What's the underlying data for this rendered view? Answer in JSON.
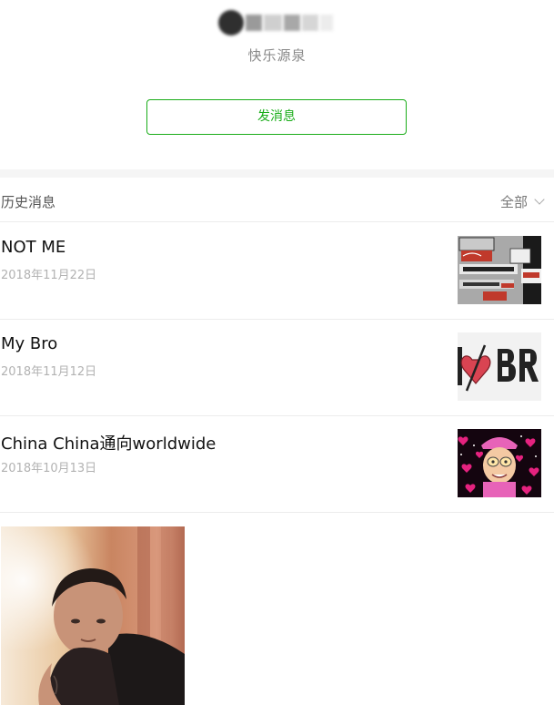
{
  "profile": {
    "subtitle": "快乐源泉"
  },
  "actions": {
    "send_message_label": "发消息"
  },
  "history": {
    "title": "历史消息",
    "filter_label": "全部"
  },
  "articles": [
    {
      "title": "NOT ME",
      "date": "2018年11月22日",
      "thumb_icon": "fashion-label-collage-icon"
    },
    {
      "title": "My Bro",
      "date": "2018年11月12日",
      "thumb_icon": "heart-bro-text-icon"
    },
    {
      "title": "China China通向worldwide",
      "date": "2018年10月13日",
      "thumb_icon": "cartoon-avatar-hearts-icon"
    }
  ],
  "colors": {
    "accent": "#1aad19",
    "muted_text": "#b2b2b2",
    "divider": "#ececec"
  }
}
